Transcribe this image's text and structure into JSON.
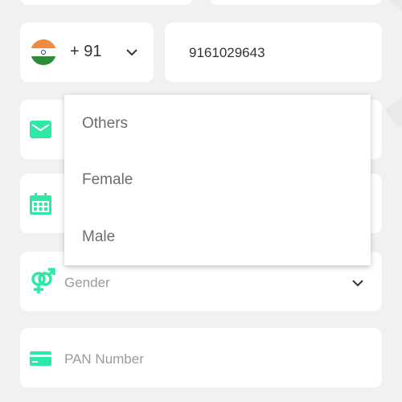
{
  "phone": {
    "country_code": "+ 91",
    "number": "9161029643",
    "flag_icon": "india-flag-icon"
  },
  "form": {
    "gender_placeholder": "Gender",
    "pan_placeholder": "PAN Number"
  },
  "gender_dropdown": {
    "options": [
      "Others",
      "Female",
      "Male"
    ]
  },
  "colors": {
    "accent": "#2ee8a6",
    "field_bg": "#ffffff",
    "page_bg": "#f1f1f1"
  }
}
